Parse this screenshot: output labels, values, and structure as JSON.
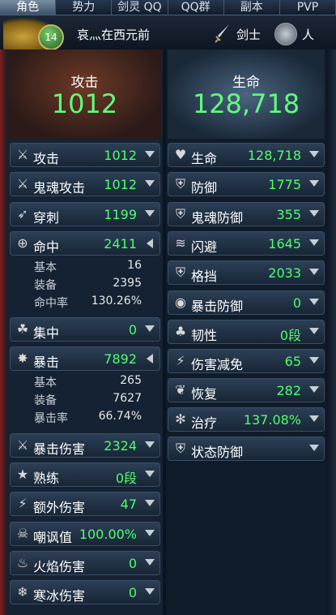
{
  "tabs": [
    "角色",
    "势力",
    "剑灵 QQ",
    "QQ群",
    "副本",
    "PVP"
  ],
  "character": {
    "level": "14",
    "name": "哀灬在西元前",
    "class": "剑士",
    "race": "人"
  },
  "attack_header": {
    "title": "攻击",
    "value": "1012"
  },
  "life_header": {
    "title": "生命",
    "value": "128,718"
  },
  "attack_stats": [
    {
      "icon": "swords-icon",
      "label": "攻击",
      "value": "1012"
    },
    {
      "icon": "ghost-sword-icon",
      "label": "鬼魂攻击",
      "value": "1012"
    },
    {
      "icon": "pierce-icon",
      "label": "穿刺",
      "value": "1199"
    },
    {
      "icon": "crosshair-icon",
      "label": "命中",
      "value": "2411",
      "details": [
        {
          "label": "基本",
          "value": "16"
        },
        {
          "label": "装备",
          "value": "2395"
        },
        {
          "label": "命中率",
          "value": "130.26%"
        }
      ]
    },
    {
      "icon": "focus-icon",
      "label": "集中",
      "value": "0"
    },
    {
      "icon": "burst-icon",
      "label": "暴击",
      "value": "7892",
      "details": [
        {
          "label": "基本",
          "value": "265"
        },
        {
          "label": "装备",
          "value": "7627"
        },
        {
          "label": "暴击率",
          "value": "66.74%"
        }
      ]
    },
    {
      "icon": "crit-damage-icon",
      "label": "暴击伤害",
      "value": "2324"
    },
    {
      "icon": "proficiency-icon",
      "label": "熟练",
      "value": "0段"
    },
    {
      "icon": "extra-damage-icon",
      "label": "额外伤害",
      "value": "47"
    },
    {
      "icon": "skull-icon",
      "label": "嘲讽值",
      "value": "100.00%"
    },
    {
      "icon": "flame-icon",
      "label": "火焰伤害",
      "value": "0"
    },
    {
      "icon": "snowflake-icon",
      "label": "寒冰伤害",
      "value": "0"
    }
  ],
  "defense_stats": [
    {
      "icon": "heart-icon",
      "label": "生命",
      "value": "128,718"
    },
    {
      "icon": "shield-icon",
      "label": "防御",
      "value": "1775"
    },
    {
      "icon": "ghost-shield-icon",
      "label": "鬼魂防御",
      "value": "355"
    },
    {
      "icon": "evade-icon",
      "label": "闪避",
      "value": "1645"
    },
    {
      "icon": "block-icon",
      "label": "格挡",
      "value": "2033"
    },
    {
      "icon": "crit-defense-icon",
      "label": "暴击防御",
      "value": "0"
    },
    {
      "icon": "toughness-icon",
      "label": "韧性",
      "value": "0段"
    },
    {
      "icon": "damage-reduction-icon",
      "label": "伤害减免",
      "value": "65"
    },
    {
      "icon": "recovery-icon",
      "label": "恢复",
      "value": "282"
    },
    {
      "icon": "heal-icon",
      "label": "治疗",
      "value": "137.08%"
    },
    {
      "icon": "status-defense-icon",
      "label": "状态防御",
      "value": ""
    }
  ],
  "colors": {
    "value_green": "#4dff6e",
    "header_green": "#5eff7b"
  }
}
